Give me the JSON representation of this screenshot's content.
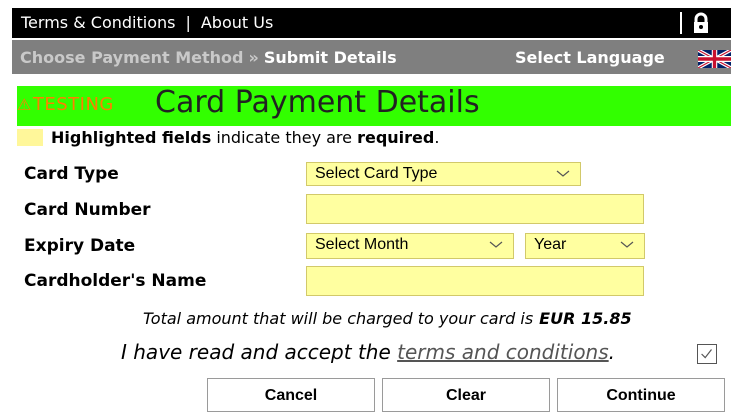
{
  "topbar": {
    "links": [
      "Terms & Conditions",
      "About Us"
    ],
    "separator": "|",
    "icon": "lock-icon"
  },
  "breadcrumb": {
    "step1": "Choose Payment Method",
    "sep": "»",
    "step2": "Submit Details",
    "language_label": "Select Language",
    "flag_icon": "uk-flag-icon"
  },
  "heading": {
    "badge": "TESTING",
    "title": "Card Payment Details"
  },
  "note": {
    "bold1": "Highlighted fields",
    "mid": " indicate they are ",
    "bold2": "required",
    "end": "."
  },
  "form": {
    "card_type_label": "Card Type",
    "card_type_value": "Select Card Type",
    "card_number_label": "Card Number",
    "card_number_value": "",
    "expiry_label": "Expiry Date",
    "month_value": "Select Month",
    "year_value": "Year",
    "cardholder_label": "Cardholder's Name",
    "cardholder_value": ""
  },
  "total": {
    "text": "Total amount that will be charged to your card is",
    "amount": "EUR 15.85"
  },
  "accept": {
    "prefix": "I have read and accept the ",
    "link": "terms and conditions",
    "suffix": "."
  },
  "buttons": {
    "cancel": "Cancel",
    "clear": "Clear",
    "continue": "Continue"
  },
  "colors": {
    "heading_bg": "#32ff00",
    "required_bg": "#ffffa0",
    "breadcrumb_bg": "#7f7f7f"
  }
}
